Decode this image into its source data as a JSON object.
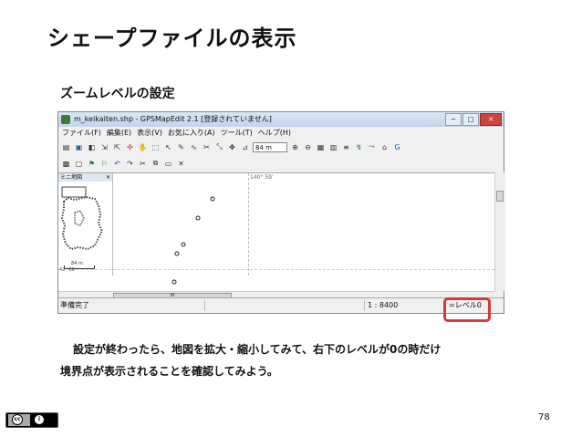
{
  "slide": {
    "title": "シェープファイルの表示",
    "section_title": "ズームレベルの設定",
    "description_line1": "設定が終わったら、地図を拡大・縮小してみて、右下のレベルが0の時だけ",
    "description_line2": "境界点が表示されることを確認してみよう。",
    "page_number": "78",
    "highlight_color": "#d63a3a"
  },
  "window": {
    "title": "m_keikaiten.shp - GPSMapEdit 2.1 [登録されていません]",
    "buttons": {
      "minimize": "─",
      "maximize": "□",
      "close": "✕"
    },
    "menu": [
      "ファイル(F)",
      "編集(E)",
      "表示(V)",
      "お気に入り(A)",
      "ツール(T)",
      "ヘルプ(H)"
    ],
    "toolbar": {
      "zoom_value": "84 m"
    },
    "minimap": {
      "title": "ミニ地図",
      "close": "✕"
    },
    "map": {
      "coord_label": "140° 59'",
      "scale_label": "84 m",
      "side_label": "42° 30'"
    },
    "hscroll_label": "III",
    "status": {
      "ready": "準備完了",
      "scale": "1 : 8400",
      "level": "=レベル0"
    }
  }
}
